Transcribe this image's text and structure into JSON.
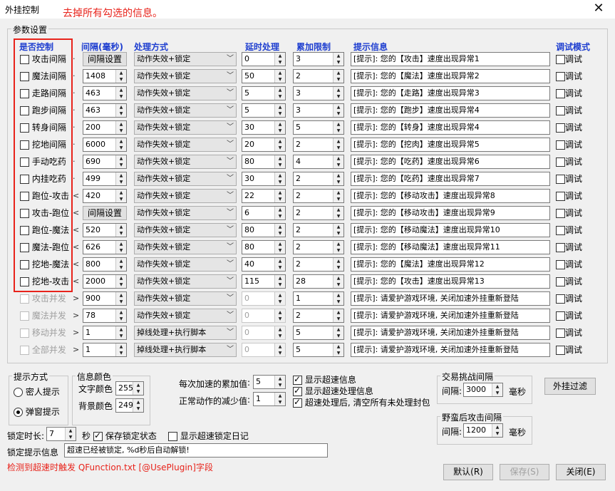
{
  "window": {
    "title": "外挂控制",
    "annotation": "去掉所有勾选的信息。",
    "close_glyph": "✕"
  },
  "params_group": {
    "label": "参数设置"
  },
  "headers": {
    "control": "是否控制",
    "interval": "间隔(毫秒)",
    "method": "处理方式",
    "delay": "延时处理",
    "accum": "累加限制",
    "tip": "提示信息",
    "debug": "调试模式"
  },
  "rows": [
    {
      "label": "攻击间隔",
      "enabled": true,
      "checked": false,
      "arrow": "·",
      "interval_button": "间隔设置",
      "interval": "",
      "method": "动作失效+锁定",
      "delay": "0",
      "accum": "3",
      "tip": "[提示]: 您的【攻击】速度出现异常1",
      "debug_label": "调试"
    },
    {
      "label": "魔法间隔",
      "enabled": true,
      "checked": false,
      "arrow": "·",
      "interval_button": "",
      "interval": "1408",
      "method": "动作失效+锁定",
      "delay": "50",
      "accum": "2",
      "tip": "[提示]: 您的【魔法】速度出现异常2",
      "debug_label": "调试"
    },
    {
      "label": "走路间隔",
      "enabled": true,
      "checked": false,
      "arrow": "·",
      "interval_button": "",
      "interval": "463",
      "method": "动作失效+锁定",
      "delay": "5",
      "accum": "3",
      "tip": "[提示]: 您的【走路】速度出现异常3",
      "debug_label": "调试"
    },
    {
      "label": "跑步间隔",
      "enabled": true,
      "checked": false,
      "arrow": "·",
      "interval_button": "",
      "interval": "463",
      "method": "动作失效+锁定",
      "delay": "5",
      "accum": "3",
      "tip": "[提示]: 您的【跑步】速度出现异常4",
      "debug_label": "调试"
    },
    {
      "label": "转身间隔",
      "enabled": true,
      "checked": false,
      "arrow": "·",
      "interval_button": "",
      "interval": "200",
      "method": "动作失效+锁定",
      "delay": "30",
      "accum": "5",
      "tip": "[提示]: 您的【转身】速度出现异常4",
      "debug_label": "调试"
    },
    {
      "label": "挖地间隔",
      "enabled": true,
      "checked": false,
      "arrow": "·",
      "interval_button": "",
      "interval": "6000",
      "method": "动作失效+锁定",
      "delay": "20",
      "accum": "2",
      "tip": "[提示]: 您的【挖肉】速度出现异常5",
      "debug_label": "调试"
    },
    {
      "label": "手动吃药",
      "enabled": true,
      "checked": false,
      "arrow": "·",
      "interval_button": "",
      "interval": "690",
      "method": "动作失效+锁定",
      "delay": "80",
      "accum": "4",
      "tip": "[提示]: 您的【吃药】速度出现异常6",
      "debug_label": "调试"
    },
    {
      "label": "内挂吃药",
      "enabled": true,
      "checked": false,
      "arrow": "·",
      "interval_button": "",
      "interval": "499",
      "method": "动作失效+锁定",
      "delay": "30",
      "accum": "2",
      "tip": "[提示]: 您的【吃药】速度出现异常7",
      "debug_label": "调试"
    },
    {
      "label": "跑位-攻击",
      "enabled": true,
      "checked": false,
      "arrow": "<",
      "interval_button": "",
      "interval": "420",
      "method": "动作失效+锁定",
      "delay": "22",
      "accum": "2",
      "tip": "[提示]: 您的【移动攻击】速度出现异常8",
      "debug_label": "调试"
    },
    {
      "label": "攻击-跑位",
      "enabled": true,
      "checked": false,
      "arrow": "<",
      "interval_button": "间隔设置",
      "interval": "",
      "method": "动作失效+锁定",
      "delay": "6",
      "accum": "2",
      "tip": "[提示]: 您的【移动攻击】速度出现异常9",
      "debug_label": "调试"
    },
    {
      "label": "跑位-魔法",
      "enabled": true,
      "checked": false,
      "arrow": "<",
      "interval_button": "",
      "interval": "520",
      "method": "动作失效+锁定",
      "delay": "80",
      "accum": "2",
      "tip": "[提示]: 您的【移动魔法】速度出现异常10",
      "debug_label": "调试"
    },
    {
      "label": "魔法-跑位",
      "enabled": true,
      "checked": false,
      "arrow": "<",
      "interval_button": "",
      "interval": "626",
      "method": "动作失效+锁定",
      "delay": "80",
      "accum": "2",
      "tip": "[提示]: 您的【移动魔法】速度出现异常11",
      "debug_label": "调试"
    },
    {
      "label": "挖地-魔法",
      "enabled": true,
      "checked": false,
      "arrow": "<",
      "interval_button": "",
      "interval": "800",
      "method": "动作失效+锁定",
      "delay": "40",
      "accum": "2",
      "tip": "[提示]: 您的【魔法】速度出现异常12",
      "debug_label": "调试"
    },
    {
      "label": "挖地-攻击",
      "enabled": true,
      "checked": false,
      "arrow": "<",
      "interval_button": "",
      "interval": "2000",
      "method": "动作失效+锁定",
      "delay": "115",
      "accum": "28",
      "tip": "[提示]: 您的【攻击】速度出现异常13",
      "debug_label": "调试"
    },
    {
      "label": "攻击并发",
      "enabled": false,
      "checked": false,
      "arrow": ">",
      "interval_button": "",
      "interval": "900",
      "method": "动作失效+锁定",
      "delay": "0",
      "accum": "1",
      "tip": "[提示]: 请爱护游戏环境, 关闭加速外挂重新登陆",
      "debug_label": "调试"
    },
    {
      "label": "魔法并发",
      "enabled": false,
      "checked": false,
      "arrow": ">",
      "interval_button": "",
      "interval": "78",
      "method": "动作失效+锁定",
      "delay": "0",
      "accum": "2",
      "tip": "[提示]: 请爱护游戏环境, 关闭加速外挂重新登陆",
      "debug_label": "调试"
    },
    {
      "label": "移动并发",
      "enabled": false,
      "checked": false,
      "arrow": ">",
      "interval_button": "",
      "interval": "1",
      "method": "掉线处理+执行脚本",
      "delay": "0",
      "accum": "5",
      "tip": "[提示]: 请爱护游戏环境, 关闭加速外挂重新登陆",
      "debug_label": "调试"
    },
    {
      "label": "全部并发",
      "enabled": false,
      "checked": false,
      "arrow": ">",
      "interval_button": "",
      "interval": "1",
      "method": "掉线处理+执行脚本",
      "delay": "0",
      "accum": "5",
      "tip": "[提示]: 请爱护游戏环境, 关闭加速外挂重新登陆",
      "debug_label": "调试"
    }
  ],
  "prompt_mode": {
    "label": "提示方式",
    "options": [
      {
        "label": "密人提示",
        "selected": false
      },
      {
        "label": "弹窗提示",
        "selected": true
      }
    ]
  },
  "info_color": {
    "label": "信息颜色",
    "text_color_label": "文字颜色",
    "text_color_value": "255",
    "bg_color_label": "背景颜色",
    "bg_color_value": "249"
  },
  "accel": {
    "accum_label": "每次加速的累加值",
    "accum_value": "5",
    "decrease_label": "正常动作的减少值",
    "decrease_value": "1"
  },
  "options": [
    {
      "label": "显示超速信息",
      "checked": true
    },
    {
      "label": "显示超速处理信息",
      "checked": true
    },
    {
      "label": "超速处理后, 清空所有未处理封包",
      "checked": true
    }
  ],
  "trade_group": {
    "label": "交易挑战间隔",
    "interval_label": "间隔:",
    "value": "3000",
    "unit": "毫秒"
  },
  "after_group": {
    "label": "野蛮后攻击间隔",
    "interval_label": "间隔:",
    "value": "1200",
    "unit": "毫秒"
  },
  "filter_button": "外挂过滤",
  "lock": {
    "duration_label": "锁定时长:",
    "duration_value": "7",
    "unit": "秒",
    "save_state_label": "保存锁定状态",
    "save_state_checked": true,
    "show_log_label": "显示超速锁定日记",
    "show_log_checked": false
  },
  "lock_tip": {
    "label": "锁定提示信息",
    "value": "超速已经被锁定, %d秒后自动解锁!"
  },
  "detect_note": "检测到超速时触发 QFunction.txt [@UsePlugin]字段",
  "buttons": {
    "default": "默认(R)",
    "save": "保存(S)",
    "close": "关闭(E)"
  }
}
